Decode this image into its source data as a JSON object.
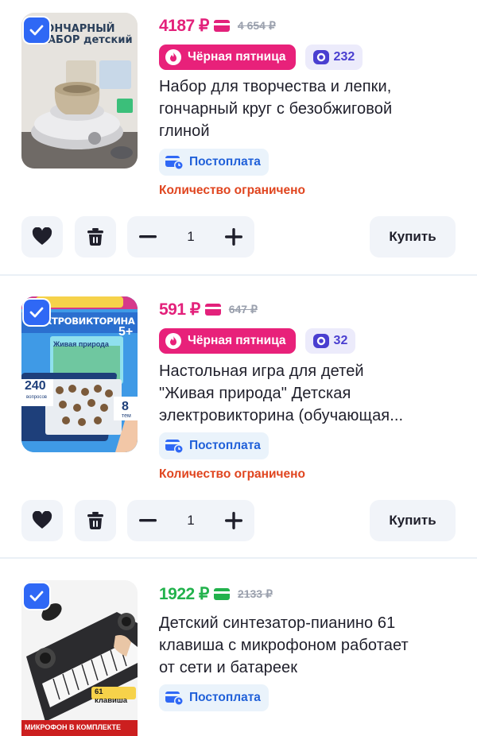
{
  "items": [
    {
      "selected": true,
      "image_caption": "ГОНЧАРНЫЙ НАБОР детский",
      "price": "4187 ₽",
      "price_color": "#e3217b",
      "old_price": "4 654 ₽",
      "promo_label": "Чёрная пятница",
      "bonus": "232",
      "title_lines": [
        "Набор для творчества и лепки,",
        "гончарный круг с безобжиговой",
        "глиной"
      ],
      "payment_label": "Постоплата",
      "stock_note": "Количество ограничено",
      "quantity": "1",
      "buy_label": "Купить"
    },
    {
      "selected": true,
      "image_caption": "ЭЛЕКТРОВИКТОРИНА",
      "image_sub": "Живая природа",
      "image_age": "5+",
      "image_count": "240",
      "image_count_sub": "вопросов",
      "image_topics": "8",
      "image_topics_sub": "тем",
      "price": "591 ₽",
      "price_color": "#e3217b",
      "old_price": "647 ₽",
      "promo_label": "Чёрная пятница",
      "bonus": "32",
      "title_lines": [
        "Настольная игра для детей",
        "\"Живая природа\" Детская",
        "электровикторина (обучающая..."
      ],
      "payment_label": "Постоплата",
      "stock_note": "Количество ограничено",
      "quantity": "1",
      "buy_label": "Купить"
    },
    {
      "selected": true,
      "image_caption": "МИКРОФОН В КОМПЛЕКТЕ",
      "image_badge": "61 клавиша",
      "price": "1922 ₽",
      "price_color": "#22b24c",
      "old_price": "2133 ₽",
      "title_lines": [
        "Детский синтезатор-пианино 61",
        "клавиша с микрофоном работает",
        "от сети и батареек"
      ],
      "payment_label": "Постоплата"
    }
  ],
  "colors": {
    "accent_blue": "#2f68f5",
    "promo_pink": "#e8217a",
    "stock_orange": "#e0451f",
    "bonus_purple": "#4a3fd0"
  }
}
